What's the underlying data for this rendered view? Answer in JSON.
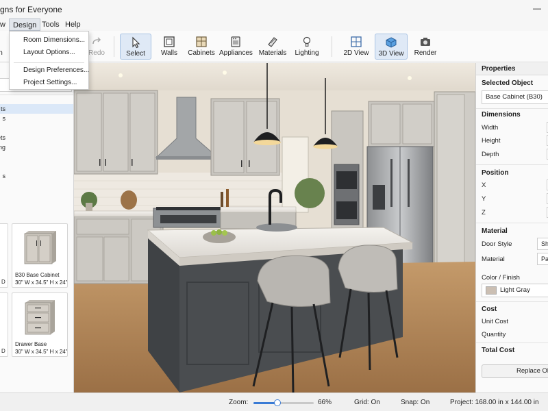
{
  "window": {
    "title": "gns for Everyone",
    "minimize_glyph": "—"
  },
  "menu": {
    "view_label": "w",
    "design_label": "Design",
    "tools_label": "Tools",
    "help_label": "Help"
  },
  "design_menu": {
    "room_dimensions": "Room Dimensions...",
    "layout_options": "Layout Options...",
    "design_preferences": "Design Preferences...",
    "project_settings": "Project Settings..."
  },
  "toolbar": {
    "cut_label": "n",
    "redo": "Redo",
    "select": "Select",
    "walls": "Walls",
    "cabinets": "Cabinets",
    "appliances": "Appliances",
    "materials": "Materials",
    "lighting": "Lighting",
    "view_2d": "2D View",
    "view_3d": "3D View",
    "render": "Render",
    "icons": [
      "redo-icon",
      "cursor-icon",
      "walls-icon",
      "cabinet-icon",
      "appliance-icon",
      "materials-icon",
      "lightbulb-icon",
      "grid-2d-icon",
      "cube-3d-icon",
      "camera-icon"
    ]
  },
  "left_panel": {
    "tree": [
      "ts",
      "s",
      "nets",
      "ng",
      "",
      "s"
    ],
    "cards": [
      {
        "name": "B30 Base Cabinet",
        "dims": "30\" W x 34.5\" H x 24\" D"
      },
      {
        "name": "Drawer Base",
        "dims": "30\" W x 34.5\" H x 24\" D"
      }
    ],
    "cut_card_dims": [
      "D",
      "D"
    ]
  },
  "properties": {
    "header": "Properties",
    "selected_object_label": "Selected Object",
    "selected_object_value": "Base Cabinet (B30)",
    "dimensions_label": "Dimensions",
    "width_label": "Width",
    "height_label": "Height",
    "depth_label": "Depth",
    "position_label": "Position",
    "x_label": "X",
    "y_label": "Y",
    "z_label": "Z",
    "material_label": "Material",
    "door_style_label": "Door Style",
    "door_style_value": "Sha",
    "material_field_label": "Material",
    "material_value": "Pain",
    "color_finish_label": "Color / Finish",
    "color_value": "Light Gray",
    "color_hex": "#cbbfb3",
    "cost_label": "Cost",
    "unit_cost_label": "Unit Cost",
    "quantity_label": "Quantity",
    "total_cost_label": "Total Cost",
    "replace_button": "Replace Obje"
  },
  "status": {
    "zoom_label": "Zoom:",
    "zoom_value": "66%",
    "zoom_fraction": 0.66,
    "grid": "Grid:  On",
    "snap": "Snap:  On",
    "project": "Project:  168.00 in x 144.00 in"
  },
  "colors": {
    "accent": "#3a7bd5",
    "selected_bg": "#dfe9f6",
    "island_base": "#4a4d50",
    "cabinet": "#c9c6c0",
    "floor": "#b88d60"
  }
}
